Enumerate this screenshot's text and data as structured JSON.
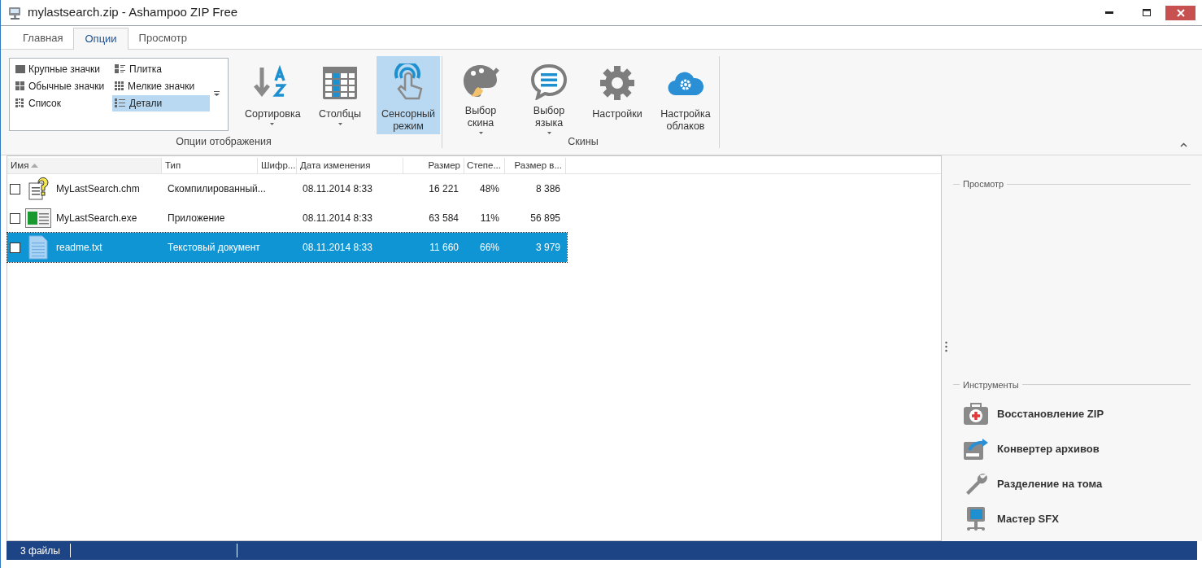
{
  "window": {
    "title": "mylastsearch.zip - Ashampoo ZIP Free"
  },
  "tabs": [
    {
      "label": "Главная",
      "selected": false
    },
    {
      "label": "Опции",
      "selected": true
    },
    {
      "label": "Просмотр",
      "selected": false
    }
  ],
  "ribbon": {
    "groups": [
      {
        "label": "Опции отображения",
        "gallery": [
          {
            "kind": "large",
            "label": "Крупные значки",
            "selected": false
          },
          {
            "kind": "tile",
            "label": "Плитка",
            "selected": false
          },
          {
            "kind": "normal",
            "label": "Обычные значки",
            "selected": false
          },
          {
            "kind": "small",
            "label": "Мелкие значки",
            "selected": false
          },
          {
            "kind": "list",
            "label": "Список",
            "selected": false
          },
          {
            "kind": "details",
            "label": "Детали",
            "selected": true
          }
        ],
        "buttons": [
          {
            "kind": "sort",
            "label": "Сортировка",
            "menu": true,
            "selected": false
          },
          {
            "kind": "columns",
            "label": "Столбцы",
            "menu": true,
            "selected": false
          },
          {
            "kind": "touch",
            "label": "Сенсорный режим",
            "menu": false,
            "selected": true
          }
        ]
      },
      {
        "label": "Скины",
        "buttons": [
          {
            "kind": "skin",
            "label": "Выбор скина",
            "menu": true,
            "selected": false
          },
          {
            "kind": "language",
            "label": "Выбор языка",
            "menu": true,
            "selected": false
          },
          {
            "kind": "settings",
            "label": "Настройки",
            "menu": false,
            "selected": false
          },
          {
            "kind": "cloud",
            "label": "Настройка облаков",
            "menu": false,
            "selected": false
          }
        ]
      }
    ]
  },
  "table": {
    "columns": [
      {
        "label": "Имя",
        "sorted": true
      },
      {
        "label": "Тип",
        "sorted": false
      },
      {
        "label": "Шифр...",
        "sorted": false
      },
      {
        "label": "Дата изменения",
        "sorted": false
      },
      {
        "label": "Размер",
        "sorted": false
      },
      {
        "label": "Степе...",
        "sorted": false
      },
      {
        "label": "Размер в...",
        "sorted": false
      }
    ],
    "rows": [
      {
        "kind": "help",
        "checked": false,
        "selected": false,
        "cells": [
          "MyLastSearch.chm",
          "Скомпилированный...",
          "",
          "08.11.2014 8:33",
          "16 221",
          "48%",
          "8 386"
        ]
      },
      {
        "kind": "app",
        "checked": false,
        "selected": false,
        "cells": [
          "MyLastSearch.exe",
          "Приложение",
          "",
          "08.11.2014 8:33",
          "63 584",
          "11%",
          "56 895"
        ]
      },
      {
        "kind": "text",
        "checked": false,
        "selected": true,
        "cells": [
          "readme.txt",
          "Текстовый документ",
          "",
          "08.11.2014 8:33",
          "11 660",
          "66%",
          "3 979"
        ]
      }
    ]
  },
  "side_panel": {
    "preview_label": "Просмотр",
    "tools_label": "Инструменты",
    "tools": [
      {
        "kind": "repair",
        "label": "Восстановление ZIP"
      },
      {
        "kind": "convert",
        "label": "Конвертер архивов"
      },
      {
        "kind": "split",
        "label": "Разделение на тома"
      },
      {
        "kind": "sfx",
        "label": "Мастер SFX"
      }
    ]
  },
  "status_bar": {
    "text": "3 файлы"
  }
}
